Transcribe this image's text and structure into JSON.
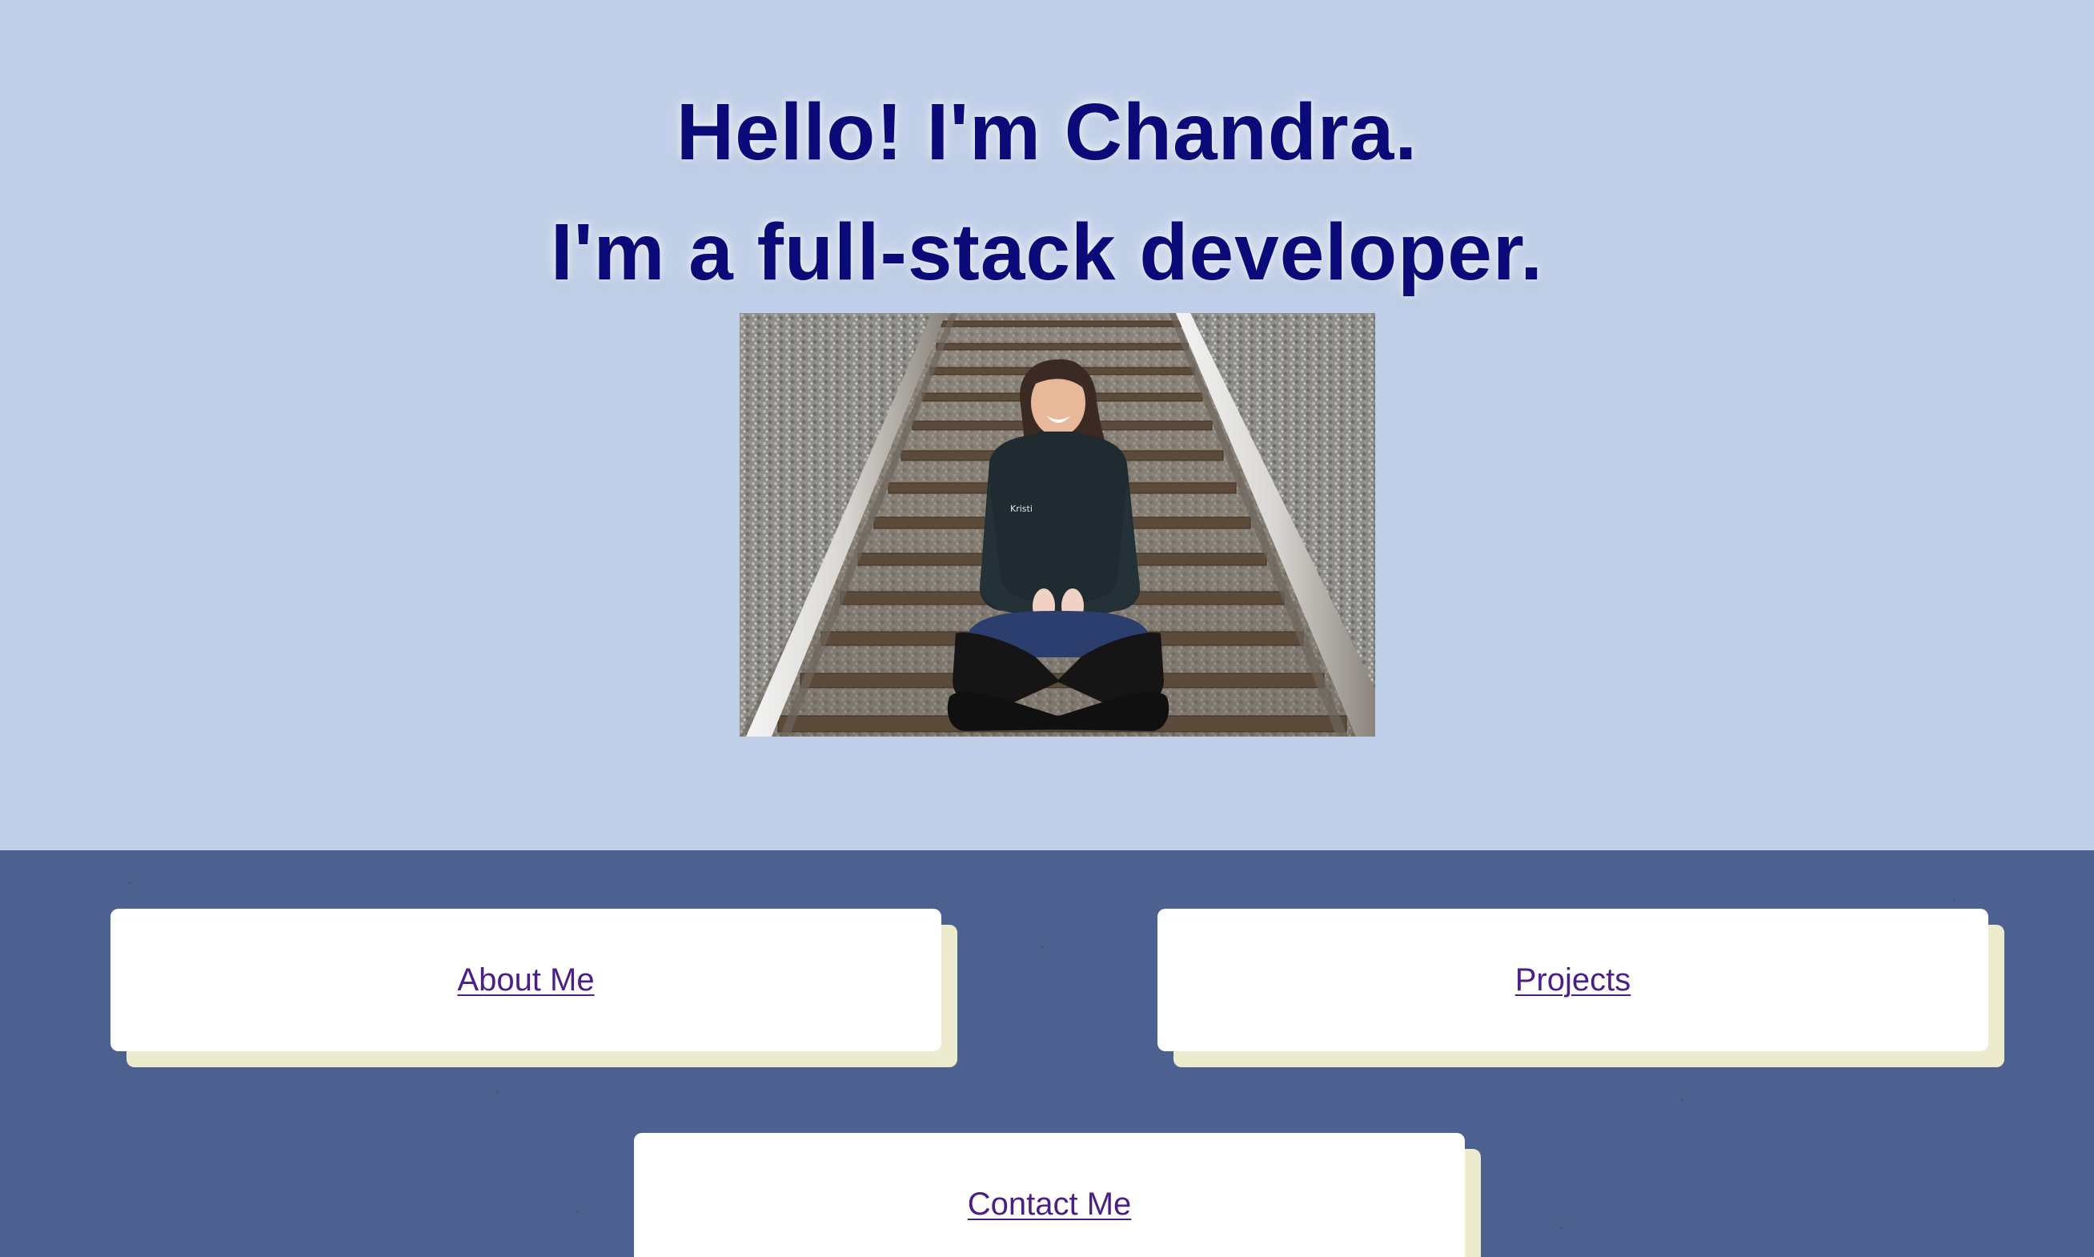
{
  "hero": {
    "line1": "Hello! I'm Chandra.",
    "line2": "I'm a full-stack developer.",
    "photo_alt": "Chandra sitting on railroad tracks",
    "background_color": "#bfcfe8",
    "headline_color": "#0a0a78"
  },
  "nav": {
    "background_color": "#4d6190",
    "card_shadow_color": "#ecebcd",
    "link_color": "#4b1f86",
    "about_label": "About Me",
    "projects_label": "Projects",
    "contact_label": "Contact Me"
  }
}
